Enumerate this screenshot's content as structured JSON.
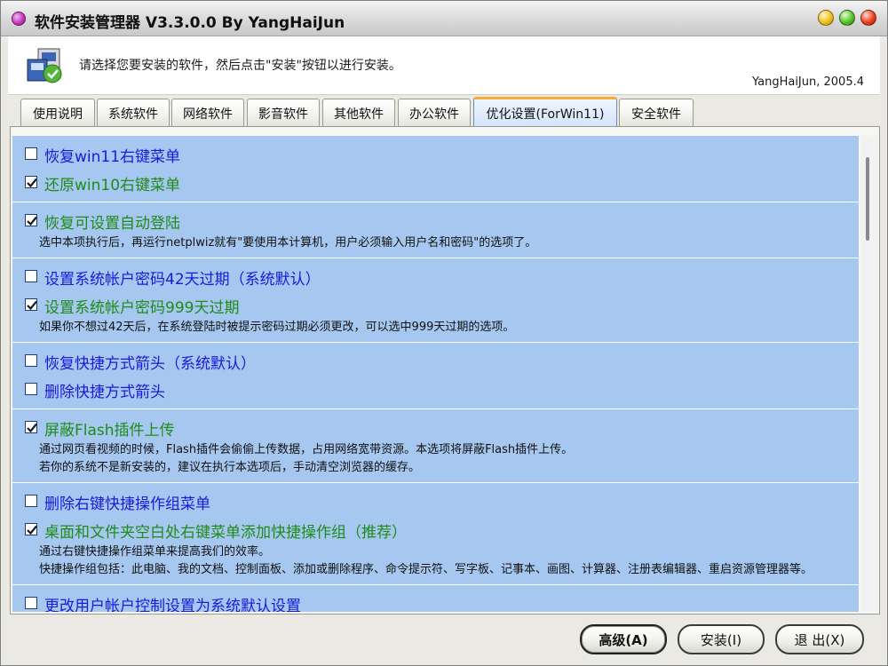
{
  "window": {
    "title": "软件安装管理器 V3.3.0.0 By YangHaiJun"
  },
  "header": {
    "instruction": "请选择您要安装的软件，然后点击\"安装\"按钮以进行安装。",
    "author": "YangHaiJun, 2005.4"
  },
  "tabs": [
    {
      "label": "使用说明"
    },
    {
      "label": "系统软件"
    },
    {
      "label": "网络软件"
    },
    {
      "label": "影音软件"
    },
    {
      "label": "其他软件"
    },
    {
      "label": "办公软件"
    },
    {
      "label": "优化设置(ForWin11)",
      "active": true
    },
    {
      "label": "安全软件"
    }
  ],
  "groups": [
    {
      "options": [
        {
          "label": "恢复win11右键菜单",
          "checked": false
        },
        {
          "label": "还原win10右键菜单",
          "checked": true
        }
      ],
      "desc": []
    },
    {
      "options": [
        {
          "label": "恢复可设置自动登陆",
          "checked": true
        }
      ],
      "desc": [
        "选中本项执行后，再运行netplwiz就有\"要使用本计算机，用户必须输入用户名和密码\"的选项了。"
      ]
    },
    {
      "options": [
        {
          "label": "设置系统帐户密码42天过期（系统默认）",
          "checked": false
        },
        {
          "label": "设置系统帐户密码999天过期",
          "checked": true
        }
      ],
      "desc": [
        "如果你不想过42天后，在系统登陆时被提示密码过期必须更改，可以选中999天过期的选项。"
      ]
    },
    {
      "options": [
        {
          "label": "恢复快捷方式箭头（系统默认）",
          "checked": false
        },
        {
          "label": "删除快捷方式箭头",
          "checked": false
        }
      ],
      "desc": []
    },
    {
      "options": [
        {
          "label": "屏蔽Flash插件上传",
          "checked": true
        }
      ],
      "desc": [
        "通过网页看视频的时候，Flash插件会偷偷上传数据，占用网络宽带资源。本选项将屏蔽Flash插件上传。",
        "若你的系统不是新安装的，建议在执行本选项后，手动清空浏览器的缓存。"
      ]
    },
    {
      "options": [
        {
          "label": "删除右键快捷操作组菜单",
          "checked": false
        },
        {
          "label": "桌面和文件夹空白处右键菜单添加快捷操作组（推荐）",
          "checked": true
        }
      ],
      "desc": [
        "通过右键快捷操作组菜单来提高我们的效率。",
        "快捷操作组包括：此电脑、我的文档、控制面板、添加或删除程序、命令提示符、写字板、记事本、画图、计算器、注册表编辑器、重启资源管理器等。"
      ]
    },
    {
      "options": [
        {
          "label": "更改用户帐户控制设置为系统默认设置",
          "checked": false
        }
      ],
      "desc": []
    }
  ],
  "buttons": {
    "advanced": "高级(A)",
    "install": "安装(I)",
    "exit": "退 出(X)"
  },
  "colors": {
    "list_bg": "#a6c7ef",
    "checked_text": "#1f8c1a",
    "unchecked_text": "#1a1ad8",
    "active_tab_accent": "#f8a93a"
  }
}
